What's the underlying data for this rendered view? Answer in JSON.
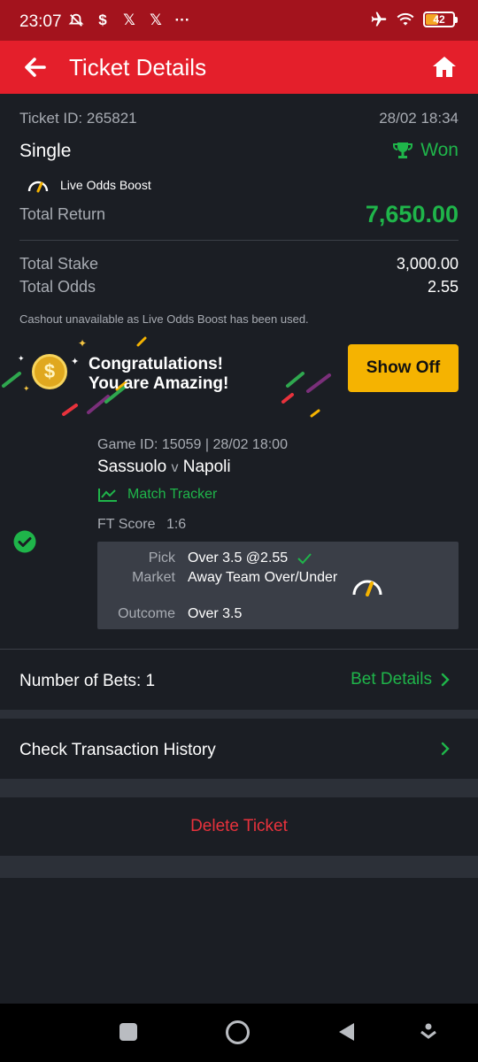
{
  "status_bar": {
    "time": "23:07",
    "battery": "42",
    "icons_left": [
      "mute-icon",
      "dollar-icon",
      "x-icon",
      "x-icon",
      "more-icon"
    ],
    "icons_right": [
      "airplane-icon",
      "wifi-icon",
      "battery-icon"
    ]
  },
  "header": {
    "title": "Ticket Details",
    "back_icon": "arrow-left-icon",
    "home_icon": "home-icon",
    "color": "#e41f2b"
  },
  "ticket": {
    "id_label": "Ticket ID: 265821",
    "datetime": "28/02 18:34",
    "type": "Single",
    "status": "Won",
    "boost_label": "Live Odds Boost",
    "total_return_label": "Total Return",
    "total_return_value": "7,650.00",
    "total_stake_label": "Total Stake",
    "total_stake_value": "3,000.00",
    "total_odds_label": "Total Odds",
    "total_odds_value": "2.55",
    "cashout_note": "Cashout unavailable as Live Odds Boost has been used."
  },
  "banner": {
    "line1": "Congratulations!",
    "line2": "You are Amazing!",
    "button": "Show Off",
    "button_color": "#f5b301"
  },
  "game": {
    "game_line": "Game ID: 15059 | 28/02 18:00",
    "home_team": "Sassuolo",
    "vs": "v",
    "away_team": "Napoli",
    "tracker": "Match Tracker",
    "ft_label": "FT Score",
    "ft_value": "1:6",
    "pick_label": "Pick",
    "pick_value": "Over 3.5 @2.55",
    "market_label": "Market",
    "market_value": "Away Team Over/Under",
    "outcome_label": "Outcome",
    "outcome_value": "Over 3.5"
  },
  "footer": {
    "num_bets": "Number of Bets: 1",
    "bet_details": "Bet Details",
    "transaction_history": "Check Transaction History",
    "delete_ticket": "Delete Ticket"
  },
  "colors": {
    "win_green": "#1fb54a",
    "delete_red": "#e8323c",
    "background": "#1b1e24"
  }
}
